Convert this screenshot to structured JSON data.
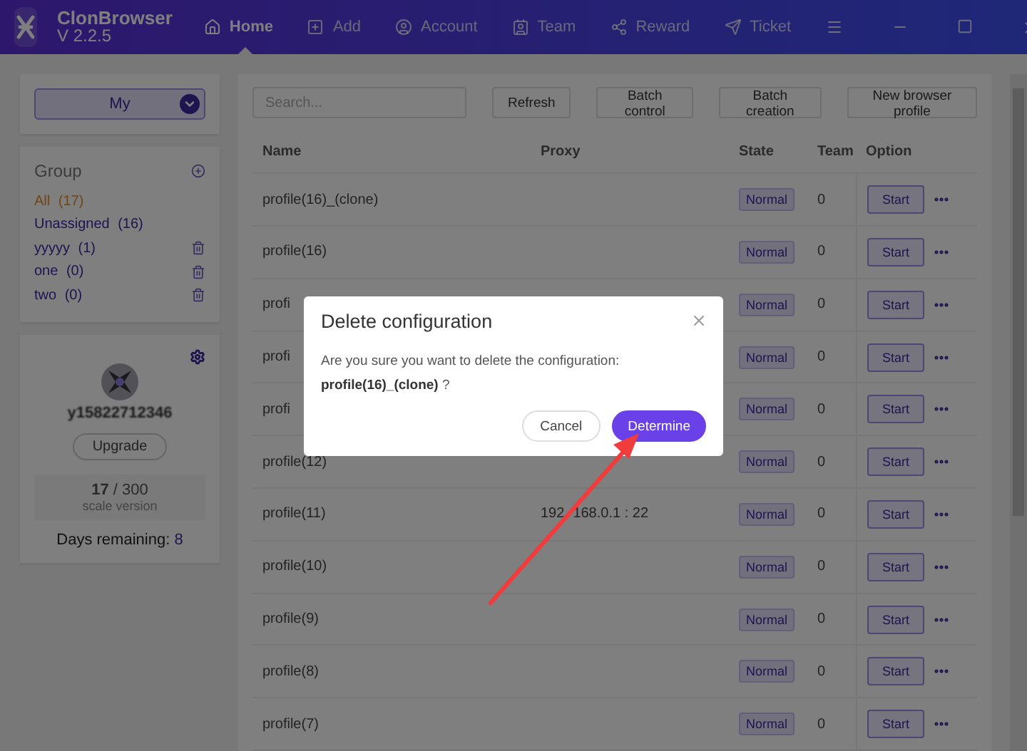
{
  "app": {
    "name": "ClonBrowser",
    "version": "V 2.2.5"
  },
  "nav": [
    {
      "label": "Home",
      "selected": true
    },
    {
      "label": "Add",
      "selected": false
    },
    {
      "label": "Account",
      "selected": false
    },
    {
      "label": "Team",
      "selected": false
    },
    {
      "label": "Reward",
      "selected": false
    },
    {
      "label": "Ticket",
      "selected": false
    }
  ],
  "scope": "My",
  "group": {
    "title": "Group",
    "items": [
      {
        "name": "All",
        "count": "(17)",
        "selected": true,
        "deletable": false
      },
      {
        "name": "Unassigned",
        "count": "(16)",
        "selected": false,
        "deletable": false
      },
      {
        "name": "yyyyy",
        "count": "(1)",
        "selected": false,
        "deletable": true
      },
      {
        "name": "one",
        "count": "(0)",
        "selected": false,
        "deletable": true
      },
      {
        "name": "two",
        "count": "(0)",
        "selected": false,
        "deletable": true
      }
    ]
  },
  "account": {
    "username": "y15822712346",
    "upgrade": "Upgrade",
    "used": "17",
    "total": " / 300",
    "plan": "scale version",
    "days_label": "Days remaining: ",
    "days": "8"
  },
  "toolbar": {
    "search_placeholder": "Search...",
    "refresh": "Refresh",
    "buttons": [
      "Batch control",
      "Batch creation",
      "New browser profile"
    ]
  },
  "table": {
    "columns": [
      "Name",
      "Proxy",
      "State",
      "Team",
      "Option"
    ],
    "rows": [
      {
        "name": "profile(16)_(clone)",
        "state": "Normal",
        "team": "0",
        "action": "Start"
      },
      {
        "name": "profile(16)",
        "state": "Normal",
        "team": "0",
        "action": "Start"
      },
      {
        "name": "profi",
        "state": "Normal",
        "team": "0",
        "action": "Start"
      },
      {
        "name": "profi",
        "state": "Normal",
        "team": "0",
        "action": "Start"
      },
      {
        "name": "profi",
        "state": "Normal",
        "team": "0",
        "action": "Start"
      },
      {
        "name": "profile(12)",
        "state": "Normal",
        "team": "0",
        "action": "Start"
      },
      {
        "name": "profile(11)",
        "proxy_parts": [
          "192",
          "168.0.1 : 22"
        ],
        "state": "Normal",
        "team": "0",
        "action": "Start"
      },
      {
        "name": "profile(10)",
        "state": "Normal",
        "team": "0",
        "action": "Start"
      },
      {
        "name": "profile(9)",
        "state": "Normal",
        "team": "0",
        "action": "Start"
      },
      {
        "name": "profile(8)",
        "state": "Normal",
        "team": "0",
        "action": "Start"
      },
      {
        "name": "profile(7)",
        "state": "Normal",
        "team": "0",
        "action": "Start"
      }
    ]
  },
  "dialog": {
    "title": "Delete configuration",
    "message": "Are you sure you want to delete the configuration:",
    "target": "**profile(16)_(clone)** ?",
    "cancel": "Cancel",
    "confirm": "Determine"
  }
}
